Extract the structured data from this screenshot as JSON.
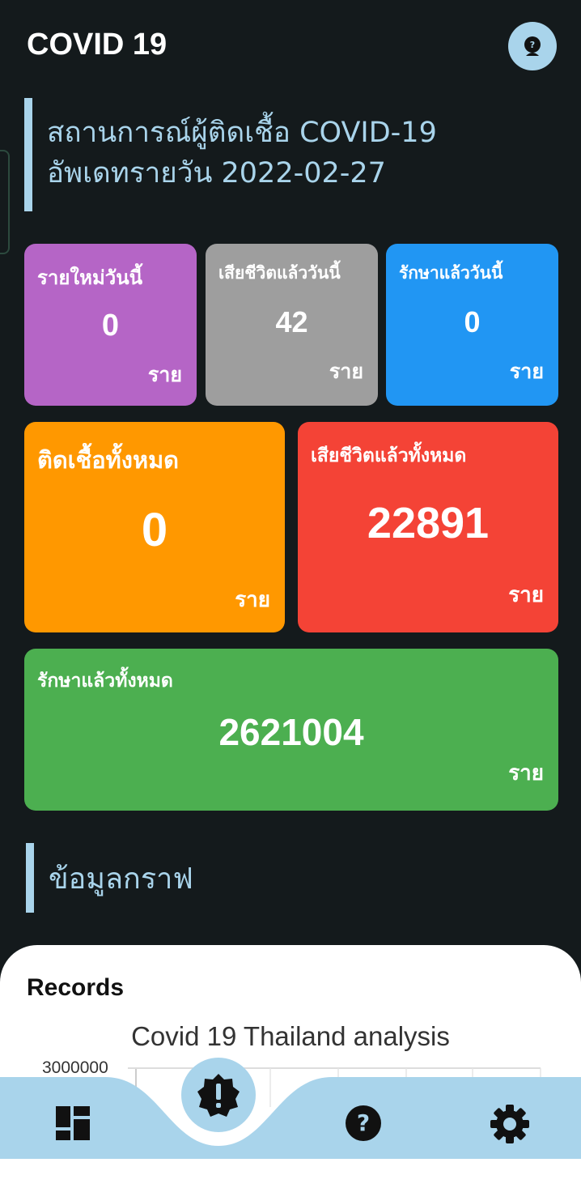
{
  "app": {
    "title": "COVID 19",
    "avatar_icon": "user-help-icon"
  },
  "heading": {
    "line1": "สถานการณ์ผู้ติดเชื้อ COVID-19",
    "line2": "อัพเดทรายวัน 2022-02-27"
  },
  "cards": {
    "new_today": {
      "label": "รายใหม่วันนี้",
      "value": "0",
      "unit": "ราย",
      "color": "#b565c6"
    },
    "deaths_today": {
      "label": "เสียชีวิตแล้ววันนี้",
      "value": "42",
      "unit": "ราย",
      "color": "#9e9e9e"
    },
    "recovered_today": {
      "label": "รักษาแล้ววันนี้",
      "value": "0",
      "unit": "ราย",
      "color": "#2196f3"
    },
    "infected_total": {
      "label": "ติดเชื้อทั้งหมด",
      "value": "0",
      "unit": "ราย",
      "color": "#ff9800"
    },
    "deaths_total": {
      "label": "เสียชีวิตแล้วทั้งหมด",
      "value": "22891",
      "unit": "ราย",
      "color": "#f44336"
    },
    "recovered_total": {
      "label": "รักษาแล้วทั้งหมด",
      "value": "2621004",
      "unit": "ราย",
      "color": "#4caf50"
    }
  },
  "graph_section": {
    "heading": "ข้อมูลกราฟ"
  },
  "chart": {
    "records_label": "Records",
    "title": "Covid 19 Thailand analysis",
    "y_tick_top": "3000000"
  },
  "bottom_nav": {
    "background": "#a9d4eb",
    "items": [
      "dashboard-icon",
      "alert-icon",
      "help-icon",
      "settings-icon"
    ]
  }
}
